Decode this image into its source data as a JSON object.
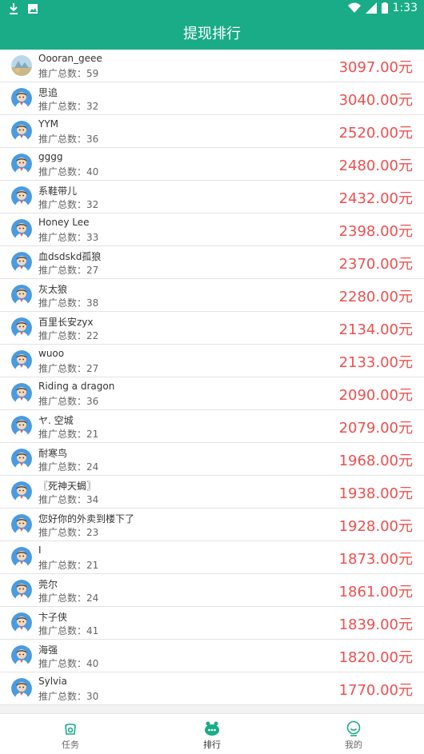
{
  "status_bar": {
    "time": "1:33"
  },
  "header": {
    "title": "提现排行"
  },
  "rows": [
    {
      "name": "Oooran_geee",
      "count": "推广总数：59",
      "amount": "3097.00元"
    },
    {
      "name": "思追",
      "count": "推广总数：32",
      "amount": "3040.00元"
    },
    {
      "name": "YYM",
      "count": "推广总数：36",
      "amount": "2520.00元"
    },
    {
      "name": "gggg",
      "count": "推广总数：40",
      "amount": "2480.00元"
    },
    {
      "name": "系鞋带儿",
      "count": "推广总数：32",
      "amount": "2432.00元"
    },
    {
      "name": "Honey Lee",
      "count": "推广总数：33",
      "amount": "2398.00元"
    },
    {
      "name": "血dsdskd孤狼",
      "count": "推广总数：27",
      "amount": "2370.00元"
    },
    {
      "name": "灰太狼",
      "count": "推广总数：38",
      "amount": "2280.00元"
    },
    {
      "name": "百里长安zyx",
      "count": "推广总数：22",
      "amount": "2134.00元"
    },
    {
      "name": "wuoo",
      "count": "推广总数：27",
      "amount": "2133.00元"
    },
    {
      "name": "Riding a dragon",
      "count": "推广总数：36",
      "amount": "2090.00元"
    },
    {
      "name": "ヤ.  空城",
      "count": "推广总数：21",
      "amount": "2079.00元"
    },
    {
      "name": "耐寒鸟",
      "count": "推广总数：24",
      "amount": "1968.00元"
    },
    {
      "name": "〖死神天蝎〗",
      "count": "推广总数：34",
      "amount": "1938.00元"
    },
    {
      "name": "您好你的外卖到楼下了",
      "count": "推广总数：23",
      "amount": "1928.00元"
    },
    {
      "name": "I",
      "count": "推广总数：21",
      "amount": "1873.00元"
    },
    {
      "name": "莞尔",
      "count": "推广总数：24",
      "amount": "1861.00元"
    },
    {
      "name": "卞子侠",
      "count": "推广总数：41",
      "amount": "1839.00元"
    },
    {
      "name": "海强",
      "count": "推广总数：40",
      "amount": "1820.00元"
    },
    {
      "name": "Sylvia",
      "count": "推广总数：30",
      "amount": "1770.00元"
    }
  ],
  "tabs": [
    {
      "label": "任务",
      "icon": "task-icon"
    },
    {
      "label": "排行",
      "icon": "ranking-icon"
    },
    {
      "label": "我的",
      "icon": "profile-icon"
    }
  ],
  "colors": {
    "primary": "#1aab87",
    "amount": "#ee4f4f"
  }
}
